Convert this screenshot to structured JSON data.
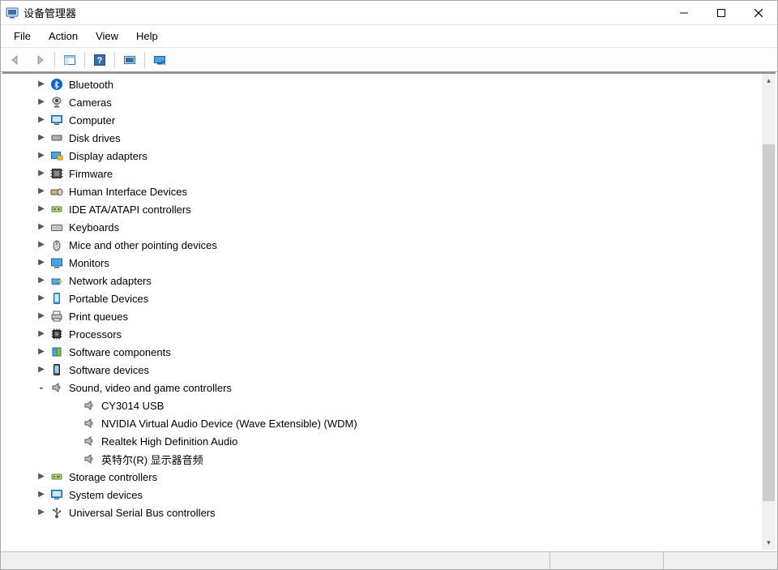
{
  "window": {
    "title": "设备管理器"
  },
  "menu": {
    "file": "File",
    "action": "Action",
    "view": "View",
    "help": "Help"
  },
  "tree": {
    "bluetooth": "Bluetooth",
    "cameras": "Cameras",
    "computer": "Computer",
    "disk_drives": "Disk drives",
    "display_adapters": "Display adapters",
    "firmware": "Firmware",
    "hid": "Human Interface Devices",
    "ide": "IDE ATA/ATAPI controllers",
    "keyboards": "Keyboards",
    "mice": "Mice and other pointing devices",
    "monitors": "Monitors",
    "network_adapters": "Network adapters",
    "portable_devices": "Portable Devices",
    "print_queues": "Print queues",
    "processors": "Processors",
    "software_components": "Software components",
    "software_devices": "Software devices",
    "sound": "Sound, video and game controllers",
    "sound_children": {
      "cy3014": "CY3014 USB",
      "nvidia_audio": "NVIDIA Virtual Audio Device (Wave Extensible) (WDM)",
      "realtek": "Realtek High Definition Audio",
      "intel_display_audio": "英特尔(R) 显示器音频"
    },
    "storage_controllers": "Storage controllers",
    "system_devices": "System devices",
    "usb_controllers": "Universal Serial Bus controllers"
  }
}
